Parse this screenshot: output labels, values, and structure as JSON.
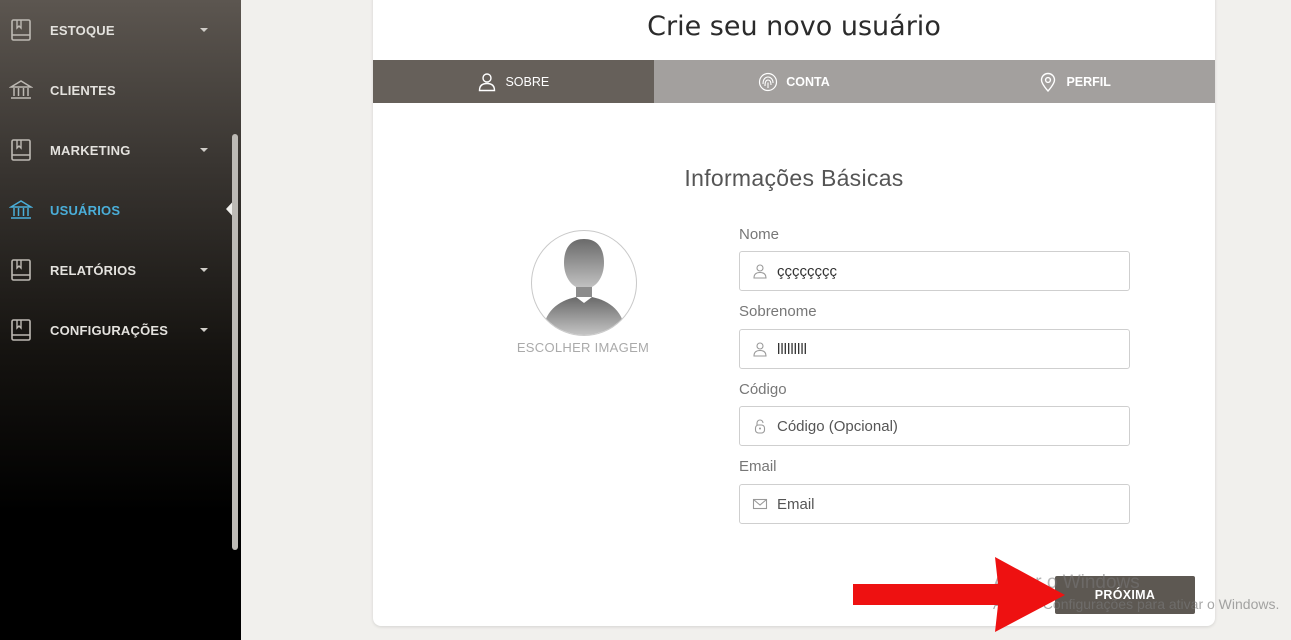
{
  "sidebar": {
    "items": [
      {
        "label": "ESTOQUE",
        "icon": "book-icon",
        "has_caret": true,
        "active": false
      },
      {
        "label": "CLIENTES",
        "icon": "bank-icon",
        "has_caret": false,
        "active": false
      },
      {
        "label": "MARKETING",
        "icon": "book-icon",
        "has_caret": true,
        "active": false
      },
      {
        "label": "USUÁRIOS",
        "icon": "bank-icon",
        "has_caret": false,
        "active": true
      },
      {
        "label": "RELATÓRIOS",
        "icon": "book-icon",
        "has_caret": true,
        "active": false
      },
      {
        "label": "CONFIGURAÇÕES",
        "icon": "book-icon",
        "has_caret": true,
        "active": false
      }
    ],
    "active_color": "#4aaed9"
  },
  "page": {
    "title": "Crie seu novo usuário",
    "tabs": [
      {
        "label": "SOBRE",
        "icon": "user-icon",
        "active": true
      },
      {
        "label": "CONTA",
        "icon": "fingerprint-icon",
        "active": false
      },
      {
        "label": "PERFIL",
        "icon": "map-pin-icon",
        "active": false
      }
    ],
    "section_title": "Informações Básicas",
    "avatar_caption": "ESCOLHER IMAGEM",
    "fields": {
      "nome": {
        "label": "Nome",
        "value": "çççççççç",
        "placeholder": "",
        "icon": "user-icon"
      },
      "sobrenome": {
        "label": "Sobrenome",
        "value": "lllllllll",
        "placeholder": "",
        "icon": "user-icon"
      },
      "codigo": {
        "label": "Código",
        "value": "",
        "placeholder": "Código (Opcional)",
        "icon": "lock-icon"
      },
      "email": {
        "label": "Email",
        "value": "",
        "placeholder": "Email",
        "icon": "envelope-icon"
      }
    },
    "next_button": "PRÓXIMA"
  },
  "watermark": {
    "line1": "Ativar o Windows",
    "line2": "Acesse Configurações para ativar o Windows."
  },
  "colors": {
    "tab_active": "#66605a",
    "tab_inactive": "#a3a09e",
    "button": "#5d5852",
    "annotation_arrow": "#ee1111"
  }
}
